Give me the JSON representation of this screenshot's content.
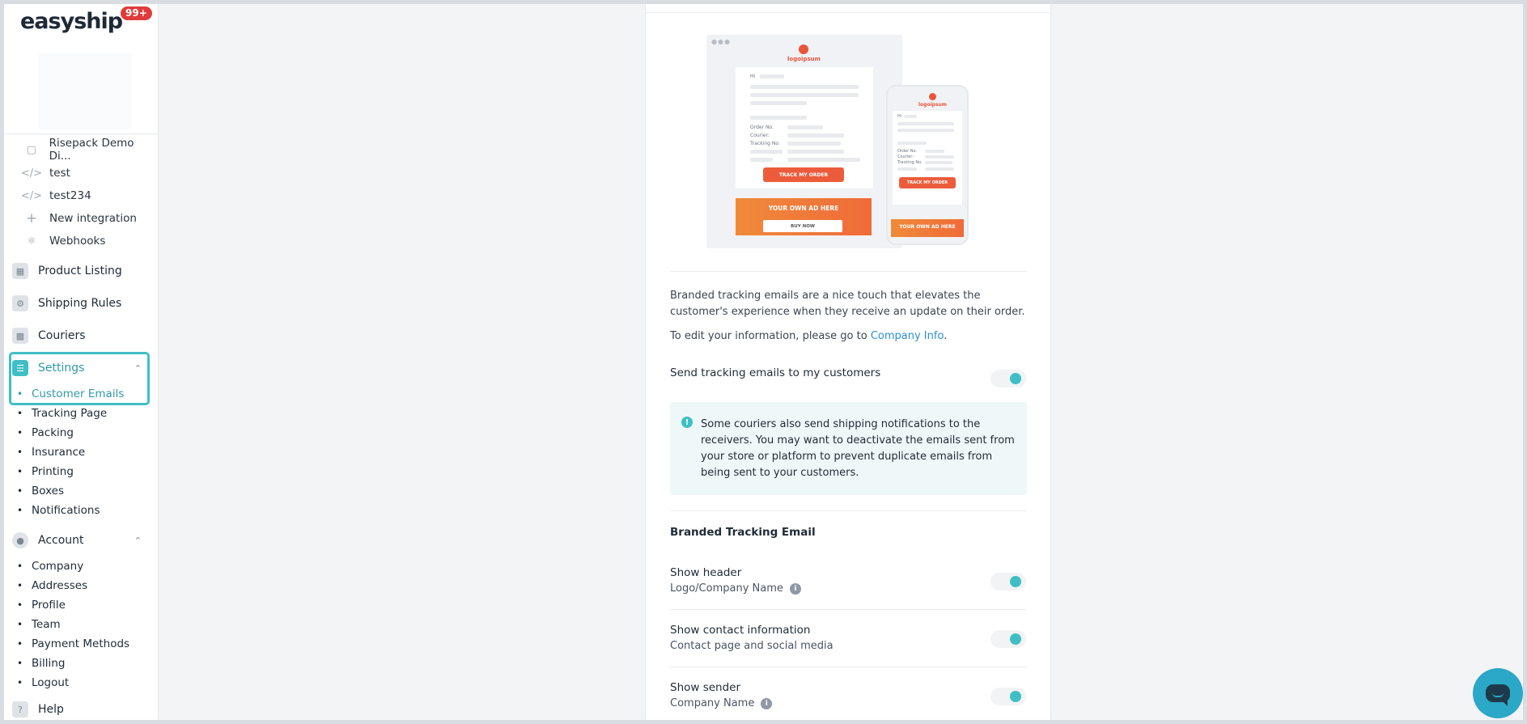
{
  "brand": {
    "logo_text": "easyship",
    "notification_count": "99+"
  },
  "sidebar": {
    "integrations": [
      {
        "label": "Risepack Demo Di...",
        "icon": "bag-icon"
      },
      {
        "label": "test",
        "icon": "code-icon"
      },
      {
        "label": "test234",
        "icon": "code-icon"
      },
      {
        "label": "New integration",
        "icon": "plus-icon"
      },
      {
        "label": "Webhooks",
        "icon": "webhook-icon"
      }
    ],
    "nav": {
      "product_listing": "Product Listing",
      "shipping_rules": "Shipping Rules",
      "couriers": "Couriers",
      "settings": "Settings",
      "account": "Account",
      "help": "Help"
    },
    "settings_items": [
      "Customer Emails",
      "Tracking Page",
      "Packing",
      "Insurance",
      "Printing",
      "Boxes",
      "Notifications"
    ],
    "account_items": [
      "Company",
      "Addresses",
      "Profile",
      "Team",
      "Payment Methods",
      "Billing",
      "Logout"
    ]
  },
  "preview": {
    "logo_text": "logoipsum",
    "greeting": "Hi",
    "order_no": "Order No.",
    "courier": "Courier:",
    "tracking_no": "Tracking No.",
    "track_button": "TRACK MY ORDER",
    "ad_text": "YOUR OWN AD HERE",
    "buy_now": "BUY NOW"
  },
  "main": {
    "intro": "Branded tracking emails are a nice touch that elevates the customer's experience when they receive an update on their order.",
    "edit_prefix": "To edit your information, please go to ",
    "edit_link": "Company Info",
    "edit_suffix": ".",
    "send_tracking_label": "Send tracking emails to my customers",
    "send_tracking_enabled": true,
    "notice": "Some couriers also send shipping notifications to the receivers. You may want to deactivate the emails sent from your store or platform to prevent duplicate emails from being sent to your customers.",
    "section_title": "Branded Tracking Email",
    "options": [
      {
        "label": "Show header",
        "sub": "Logo/Company Name",
        "has_info": true,
        "enabled": true
      },
      {
        "label": "Show contact information",
        "sub": "Contact page and social media",
        "has_info": false,
        "enabled": true
      },
      {
        "label": "Show sender",
        "sub": "Company Name",
        "has_info": true,
        "enabled": true
      }
    ]
  },
  "colors": {
    "accent": "#3fbfc5",
    "link": "#2b8fd6",
    "badge": "#e03b3b",
    "chat": "#2ba7c8"
  }
}
